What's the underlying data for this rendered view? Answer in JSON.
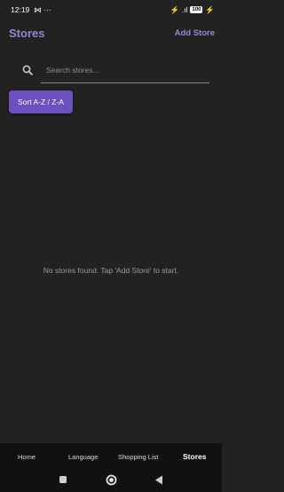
{
  "status_bar": {
    "time": "12:19",
    "notification_icons": "⋈ ···",
    "signal_text": "⚡ .ıl",
    "battery": "100",
    "charging": "⚡"
  },
  "header": {
    "title": "Stores",
    "add_store_label": "Add Store"
  },
  "search": {
    "placeholder": "Search stores...",
    "value": ""
  },
  "sort_button_label": "Sort A-Z / Z-A",
  "empty_message": "No stores found. Tap 'Add Store' to start.",
  "bottom_nav": {
    "items": [
      {
        "label": "Home"
      },
      {
        "label": "Language"
      },
      {
        "label": "Shopping List"
      },
      {
        "label": "Stores"
      }
    ],
    "active": "Stores"
  },
  "system_nav": {
    "icons": [
      "recents-icon",
      "home-icon",
      "back-icon"
    ]
  },
  "colors": {
    "background": "#222222",
    "accent": "#9b86d6",
    "button": "#6e4fc0",
    "nav_background": "#111111"
  }
}
